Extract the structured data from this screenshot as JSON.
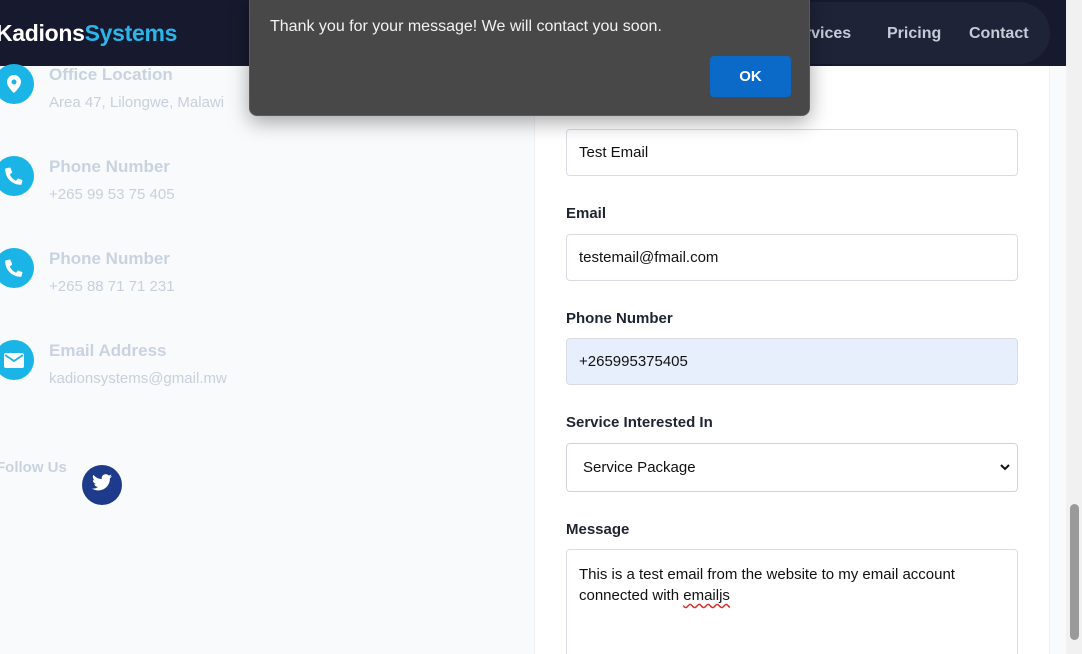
{
  "header": {
    "logo_part1": "Kadions",
    "logo_part2": "Systems",
    "nav": [
      {
        "label": "ervices"
      },
      {
        "label": "Pricing"
      },
      {
        "label": "Contact"
      }
    ]
  },
  "contact_info": {
    "items": [
      {
        "title": "Office Location",
        "value": "Area 47, Lilongwe, Malawi",
        "icon": "map-pin-icon"
      },
      {
        "title": "Phone Number",
        "value": "+265 99 53 75 405",
        "icon": "phone-icon"
      },
      {
        "title": "Phone Number",
        "value": "+265 88 71 71 231",
        "icon": "phone-icon"
      },
      {
        "title": "Email Address",
        "value": "kadionsystems@gmail.mw",
        "icon": "envelope-icon"
      }
    ],
    "follow_label": "Follow Us"
  },
  "form": {
    "subject_value": "Test Email",
    "email_label": "Email",
    "email_value": "testemail@fmail.com",
    "phone_label": "Phone Number",
    "phone_value": "+265995375405",
    "service_label": "Service Interested In",
    "service_value": "Service Package",
    "message_label": "Message",
    "message_text": "This is a test email from the website to my email account connected with",
    "message_misspelled": "emailjs"
  },
  "dialog": {
    "message": "Thank you for your message! We will contact you soon.",
    "ok_label": "OK"
  },
  "colors": {
    "brand_accent": "#2bb6ea",
    "icon_circle": "#1ab4e6",
    "header_bg": "#171a2e",
    "ok_button": "#0b69c7",
    "twitter_bg": "#1e3a8a"
  }
}
